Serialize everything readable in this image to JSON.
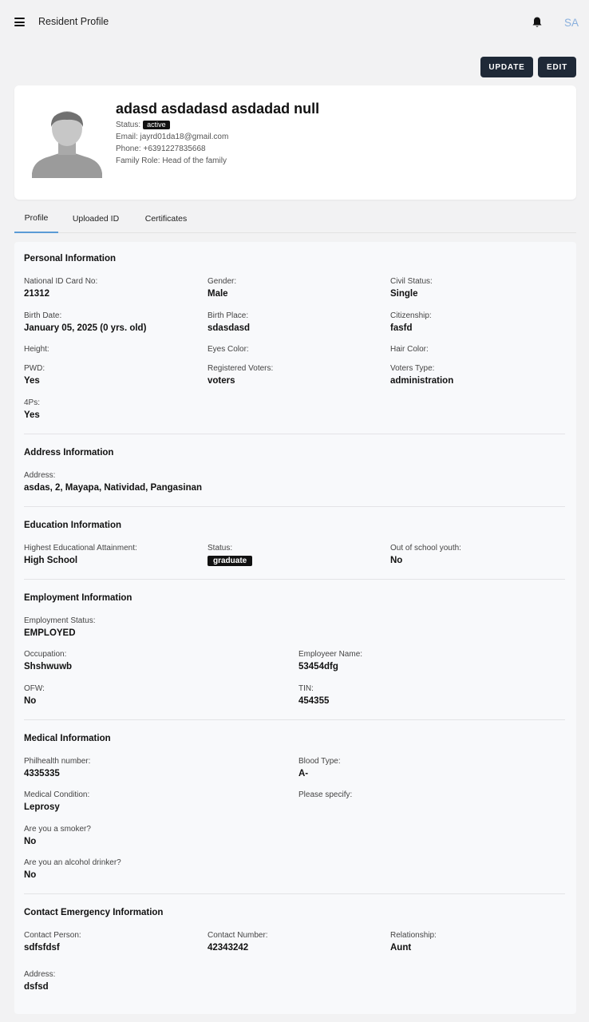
{
  "header": {
    "title": "Resident Profile",
    "user_initials": "SA"
  },
  "actions": {
    "update_label": "UPDATE",
    "edit_label": "EDIT"
  },
  "profile": {
    "name": "adasd asdadasd asdadad null",
    "status_label": "Status:",
    "status": "active",
    "email": "Email: jayrd01da18@gmail.com",
    "phone": "Phone: +6391227835668",
    "family_role": "Family Role: Head of the family"
  },
  "tabs": [
    {
      "label": "Profile"
    },
    {
      "label": "Uploaded ID"
    },
    {
      "label": "Certificates"
    }
  ],
  "personal": {
    "title": "Personal Information",
    "national_id": {
      "label": "National ID Card No:",
      "value": "21312"
    },
    "gender": {
      "label": "Gender:",
      "value": "Male"
    },
    "civil_status": {
      "label": "Civil Status:",
      "value": "Single"
    },
    "birth_date": {
      "label": "Birth Date:",
      "value": "January 05, 2025 (0 yrs. old)"
    },
    "birth_place": {
      "label": "Birth Place:",
      "value": "sdasdasd"
    },
    "citizenship": {
      "label": "Citizenship:",
      "value": "fasfd"
    },
    "height": {
      "label": "Height:",
      "value": ""
    },
    "eyes_color": {
      "label": "Eyes Color:",
      "value": ""
    },
    "hair_color": {
      "label": "Hair Color:",
      "value": ""
    },
    "pwd": {
      "label": "PWD:",
      "value": "Yes"
    },
    "registered_voters": {
      "label": "Registered Voters:",
      "value": "voters"
    },
    "voters_type": {
      "label": "Voters Type:",
      "value": "administration"
    },
    "four_ps": {
      "label": "4Ps:",
      "value": "Yes"
    }
  },
  "address": {
    "title": "Address Information",
    "address": {
      "label": "Address:",
      "value": "asdas, 2, Mayapa, Natividad, Pangasinan"
    }
  },
  "education": {
    "title": "Education Information",
    "attainment": {
      "label": "Highest Educational Attainment:",
      "value": "High School"
    },
    "status": {
      "label": "Status:",
      "value": "graduate"
    },
    "osy": {
      "label": "Out of school youth:",
      "value": "No"
    }
  },
  "employment": {
    "title": "Employment Information",
    "status": {
      "label": "Employment Status:",
      "value": "EMPLOYED"
    },
    "occupation": {
      "label": "Occupation:",
      "value": "Shshwuwb"
    },
    "employer": {
      "label": "Employeer Name:",
      "value": "53454dfg"
    },
    "ofw": {
      "label": "OFW:",
      "value": "No"
    },
    "tin": {
      "label": "TIN:",
      "value": "454355"
    }
  },
  "medical": {
    "title": "Medical Information",
    "philhealth": {
      "label": "Philhealth number:",
      "value": "4335335"
    },
    "blood_type": {
      "label": "Blood Type:",
      "value": "A-"
    },
    "condition": {
      "label": "Medical Condition:",
      "value": "Leprosy"
    },
    "specify": {
      "label": "Please specify:",
      "value": ""
    },
    "smoker": {
      "label": "Are you a smoker?",
      "value": "No"
    },
    "drinker": {
      "label": "Are you an alcohol drinker?",
      "value": "No"
    }
  },
  "emergency": {
    "title": "Contact Emergency Information",
    "person": {
      "label": "Contact Person:",
      "value": "sdfsfdsf"
    },
    "number": {
      "label": "Contact Number:",
      "value": "42343242"
    },
    "relationship": {
      "label": "Relationship:",
      "value": "Aunt"
    },
    "address": {
      "label": "Address:",
      "value": "dsfsd"
    }
  }
}
